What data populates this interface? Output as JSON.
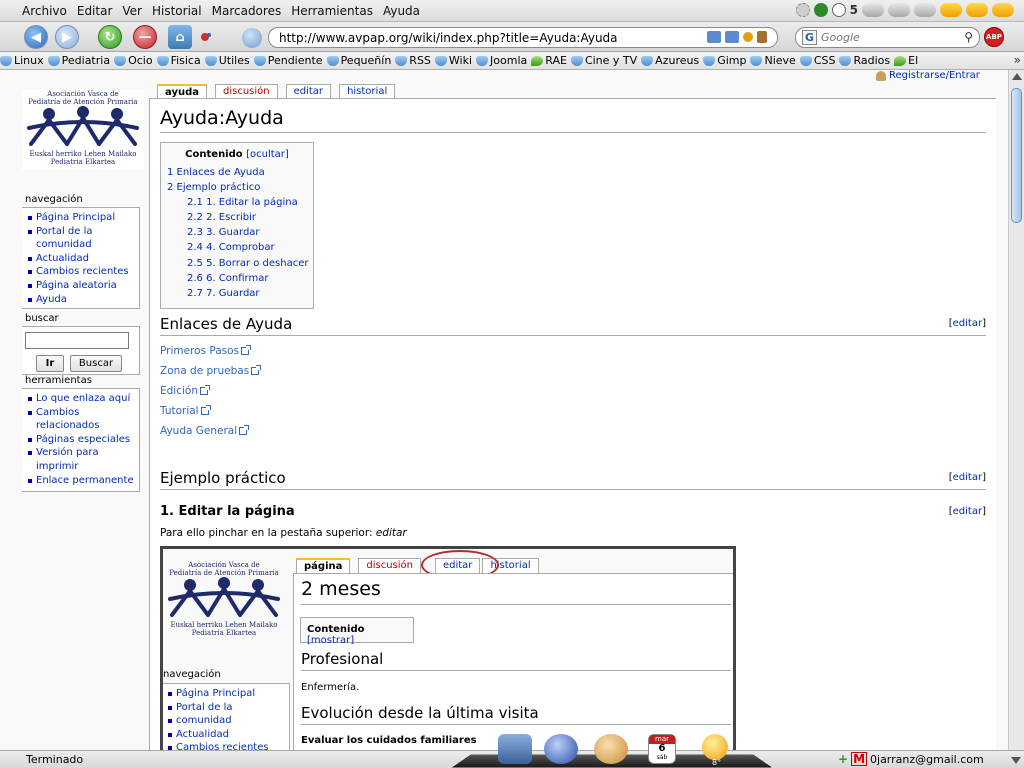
{
  "browser": {
    "menu": [
      "Archivo",
      "Editar",
      "Ver",
      "Historial",
      "Marcadores",
      "Herramientas",
      "Ayuda"
    ],
    "tray_count": "5",
    "url": "http://www.avpap.org/wiki/index.php?title=Ayuda:Ayuda",
    "search_placeholder": "Google",
    "search_engine": "G",
    "adblock_label": "ABP",
    "bookmarks": [
      "Linux",
      "Pediatria",
      "Ocio",
      "Fisica",
      "Utiles",
      "Pendiente",
      "Pequeñín",
      "RSS",
      "Wiki",
      "Joomla",
      "RAE",
      "Cine y TV",
      "Azureus",
      "Gimp",
      "Nieve",
      "CSS",
      "Radios",
      "El"
    ]
  },
  "personal": {
    "login": "Registrarse/Entrar"
  },
  "logo": {
    "top": [
      "Asociación Vasca de",
      "Pediatría de Atención Primaria"
    ],
    "bottom": [
      "Euskal herriko Lehen Mailako",
      "Pediatria Elkartea"
    ]
  },
  "sidebar": {
    "nav_heading": "navegación",
    "nav": [
      "Página Principal",
      "Portal de la comunidad",
      "Actualidad",
      "Cambios recientes",
      "Página aleatoria",
      "Ayuda"
    ],
    "search_heading": "buscar",
    "go_button": "Ir",
    "search_button": "Buscar",
    "tools_heading": "herramientas",
    "tools": [
      "Lo que enlaza aquí",
      "Cambios relacionados",
      "Páginas especiales",
      "Versión para imprimir",
      "Enlace permanente"
    ]
  },
  "tabs": [
    "ayuda",
    "discusión",
    "editar",
    "historial"
  ],
  "page": {
    "title": "Ayuda:Ayuda",
    "toc": {
      "title": "Contenido",
      "toggle": "[ocultar]",
      "items": [
        "1 Enlaces de Ayuda",
        "2 Ejemplo práctico",
        "2.1 1. Editar la página",
        "2.2 2. Escribir",
        "2.3 3. Guardar",
        "2.4 4. Comprobar",
        "2.5 5. Borrar o deshacer",
        "2.6 6. Confirmar",
        "2.7 7. Guardar"
      ]
    },
    "edit_label": "editar",
    "section1": "Enlaces de Ayuda",
    "links": [
      "Primeros Pasos",
      "Zona de pruebas",
      "Edición",
      "Tutorial",
      "Ayuda General"
    ],
    "section2": "Ejemplo práctico",
    "subsection": "1. Editar la página",
    "instruction_prefix": "Para ello pinchar en la pestaña superior:",
    "instruction_em": "editar"
  },
  "embedded": {
    "tabs": [
      "página",
      "discusión",
      "editar",
      "historial"
    ],
    "title": "2 meses",
    "toc_title": "Contenido",
    "toc_toggle": "[mostrar]",
    "h2a": "Profesional",
    "para": "Enfermería.",
    "h2b": "Evolución desde la última visita",
    "h3": "Evaluar los cuidados familiares",
    "nav_heading": "navegación",
    "nav": [
      "Página Principal",
      "Portal de la",
      "comunidad",
      "Actualidad",
      "Cambios recientes"
    ]
  },
  "status": {
    "text": "Terminado",
    "email": "0jarranz@gmail.com",
    "calendar_month": "mar",
    "calendar_day": "6",
    "calendar_weekday": "sáb",
    "temperature": "8°"
  }
}
